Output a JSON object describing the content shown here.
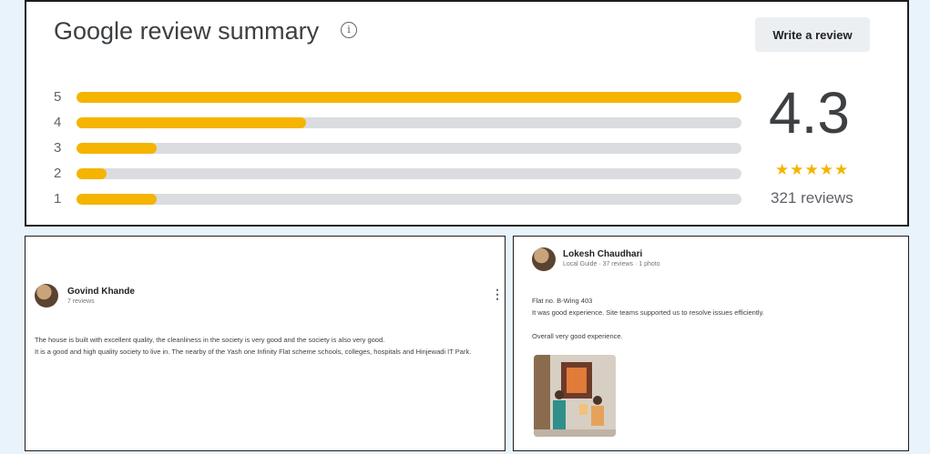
{
  "summary": {
    "title": "Google review summary",
    "info_icon": "info-icon",
    "write_review_label": "Write a review",
    "average": "4.3",
    "stars_text": "★★★★",
    "stars_half": "★",
    "review_count": "321 reviews",
    "accent_color": "#f4b400",
    "track_color": "#dadce0",
    "bars": [
      {
        "label": "5",
        "fraction": 1.0
      },
      {
        "label": "4",
        "fraction": 0.345
      },
      {
        "label": "3",
        "fraction": 0.12
      },
      {
        "label": "2",
        "fraction": 0.045
      },
      {
        "label": "1",
        "fraction": 0.12
      }
    ]
  },
  "reviews": [
    {
      "name": "Govind Khande",
      "meta": "7 reviews",
      "menu_icon": "more-vert-icon",
      "paragraphs": [
        "The house is built with excellent quality, the cleanliness in the society is very good and the society is also very good.",
        "It is a good and high quality society to live in. The nearby of the Yash one Infinity Flat scheme schools, colleges, hospitals and Hinjewadi IT Park."
      ]
    },
    {
      "name": "Lokesh Chaudhari",
      "meta": "Local Guide · 37 reviews · 1 photo",
      "paragraphs": [
        "Flat no. B-Wing 403",
        "It was good experience. Site teams supported us to resolve issues efficiently.",
        "Overall very good experience."
      ],
      "photo": "review-photo"
    }
  ]
}
